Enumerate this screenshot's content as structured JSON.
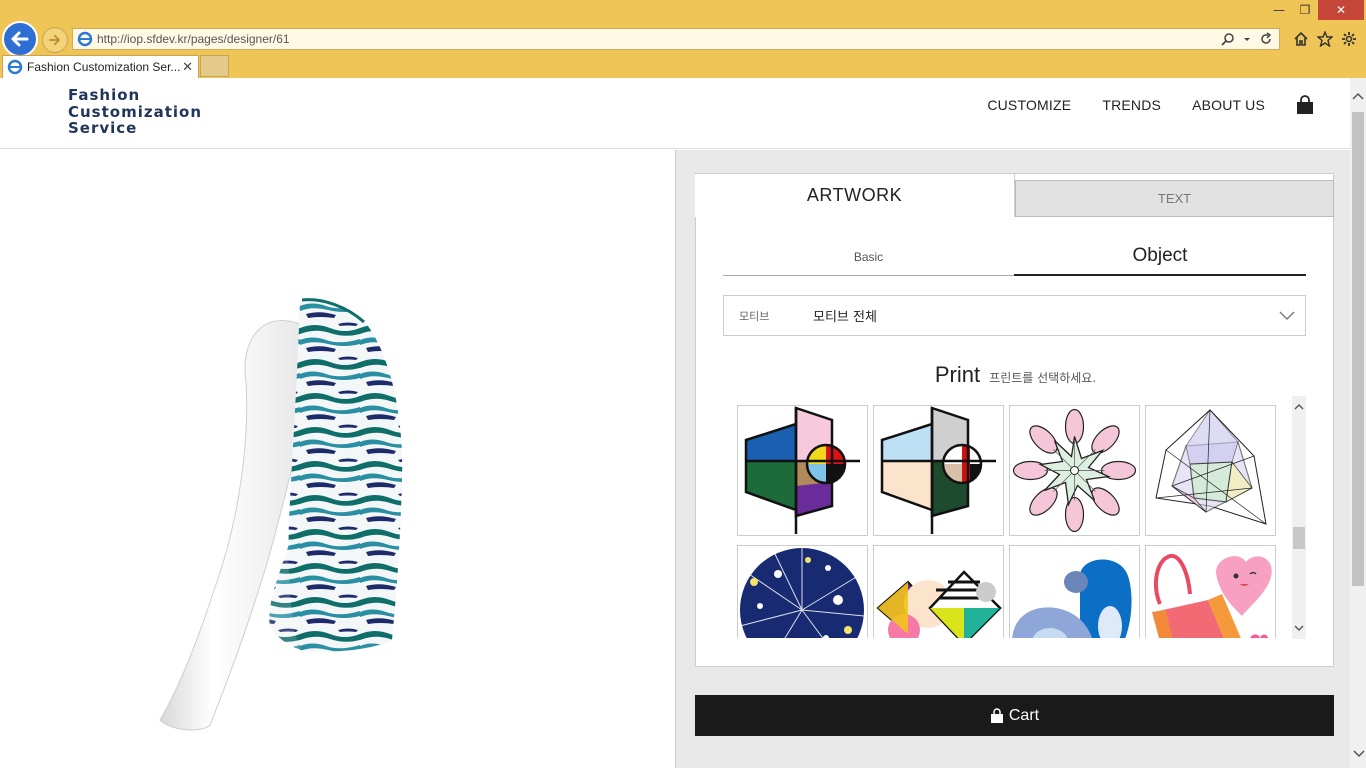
{
  "browser": {
    "url": "http://iop.sfdev.kr/pages/designer/61",
    "tab_title": "Fashion Customization Ser...",
    "tab_close": "✕",
    "win_min": "—",
    "win_max": "❐",
    "win_close": "✕"
  },
  "site": {
    "logo_lines": [
      "Fashion",
      "Customization",
      "Service"
    ],
    "nav": [
      "CUSTOMIZE",
      "TRENDS",
      "ABOUT US"
    ]
  },
  "designer": {
    "tabs": {
      "artwork": "ARTWORK",
      "text": "TEXT"
    },
    "subtabs": {
      "basic": "Basic",
      "object": "Object"
    },
    "filter": {
      "label": "모티브",
      "value": "모티브 전체"
    },
    "print_title": "Print",
    "print_subtitle": "프린트를 선택하세요.",
    "thumbnails": [
      "geometric-circle-print-color",
      "geometric-circle-print-pastel",
      "pink-mandala-print",
      "polyhedron-star-print",
      "navy-starburst-print",
      "geometric-memphis-print",
      "blue-abstract-shapes-print",
      "heart-character-bag-print"
    ],
    "cart_label": "Cart"
  },
  "colors": {
    "accent_dark": "#1a1a1a",
    "chrome": "#f0c557",
    "logo": "#1f3559"
  }
}
